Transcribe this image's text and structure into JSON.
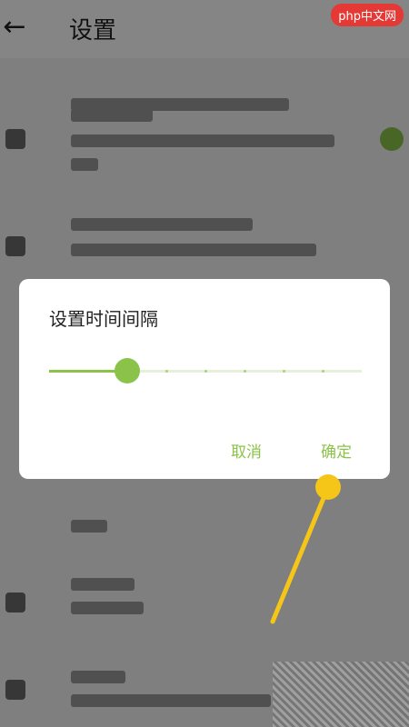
{
  "app_bar": {
    "title": "设置",
    "back_icon": "arrow-back-icon"
  },
  "brand": {
    "text": "php",
    "suffix": "中文网",
    "color": "#e53935"
  },
  "dialog": {
    "title": "设置时间间隔",
    "slider": {
      "value_fraction": 0.25,
      "steps": 8
    },
    "cancel_label": "取消",
    "confirm_label": "确定"
  },
  "colors": {
    "accent": "#8bc34a",
    "pointer": "#f5c518"
  }
}
